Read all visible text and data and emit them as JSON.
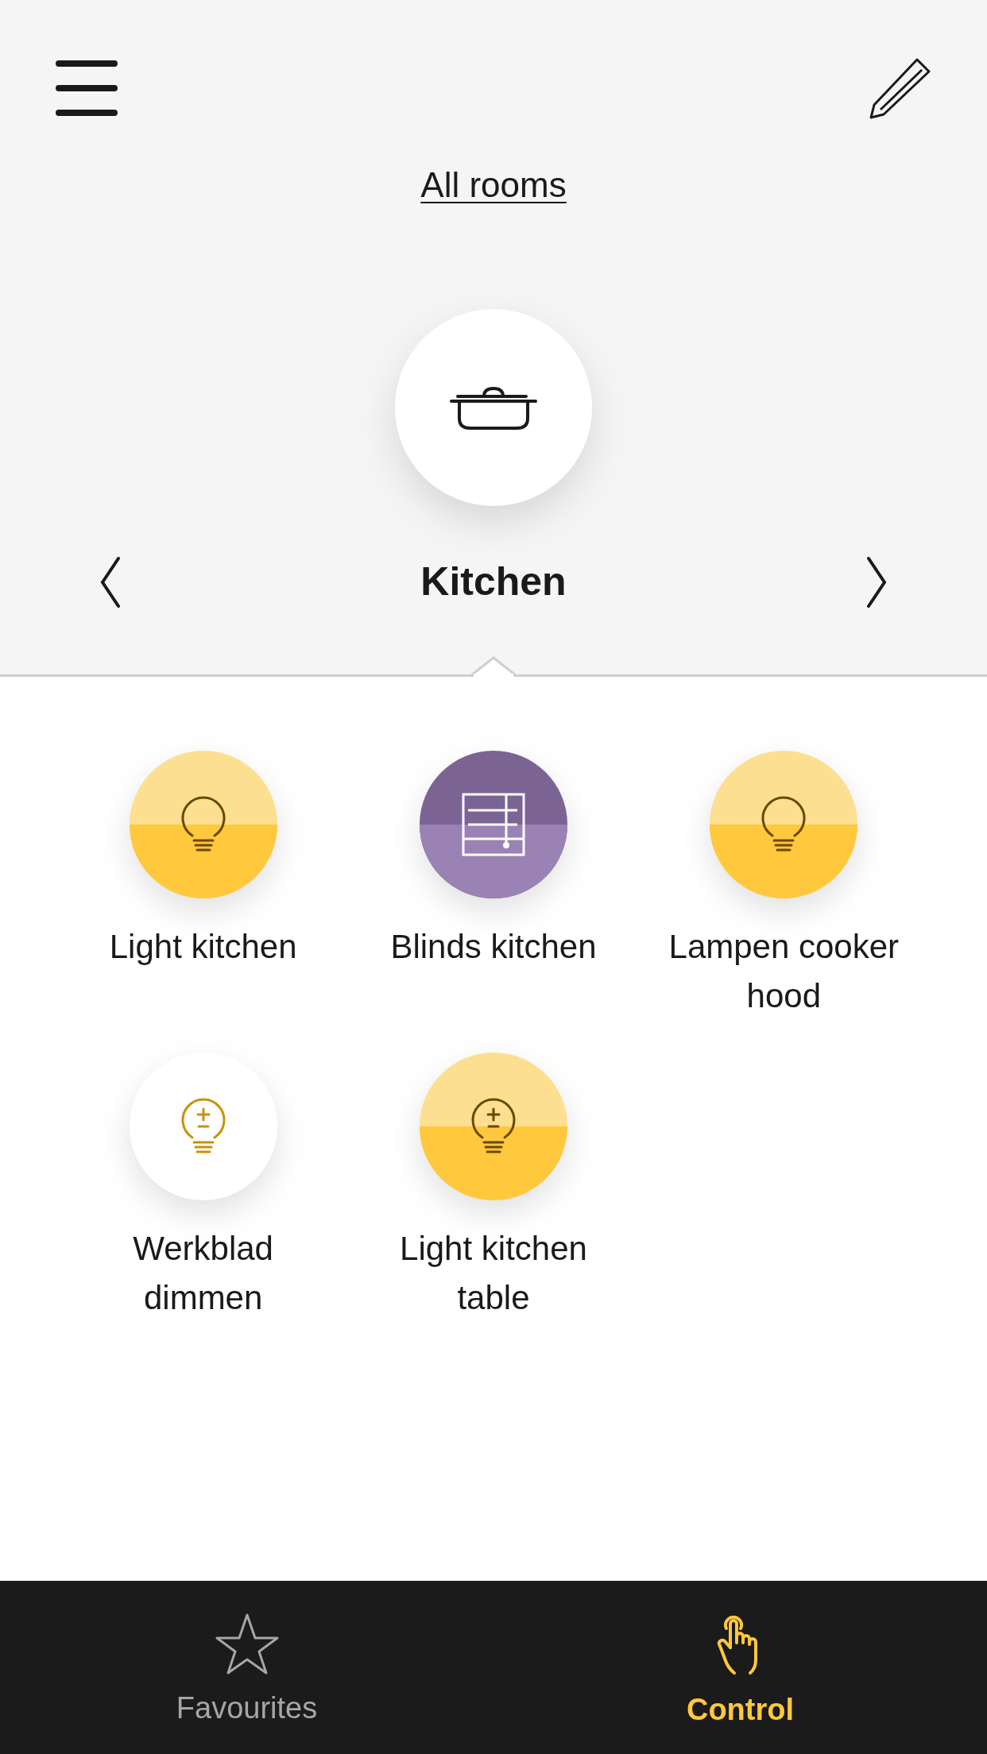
{
  "header": {
    "link": "All rooms"
  },
  "room": {
    "name": "Kitchen"
  },
  "devices": [
    {
      "kind": "light",
      "label": "Light kitchen",
      "on": true
    },
    {
      "kind": "blinds",
      "label": "Blinds kitchen",
      "on": true
    },
    {
      "kind": "light",
      "label": "Lampen cooker hood",
      "on": true
    },
    {
      "kind": "dimmer",
      "label": "Werkblad dimmen",
      "on": false
    },
    {
      "kind": "dimmer",
      "label": "Light kitchen table",
      "on": true
    }
  ],
  "tabs": [
    {
      "kind": "favourites",
      "label": "Favourites",
      "selected": false
    },
    {
      "kind": "control",
      "label": "Control",
      "selected": true
    }
  ]
}
